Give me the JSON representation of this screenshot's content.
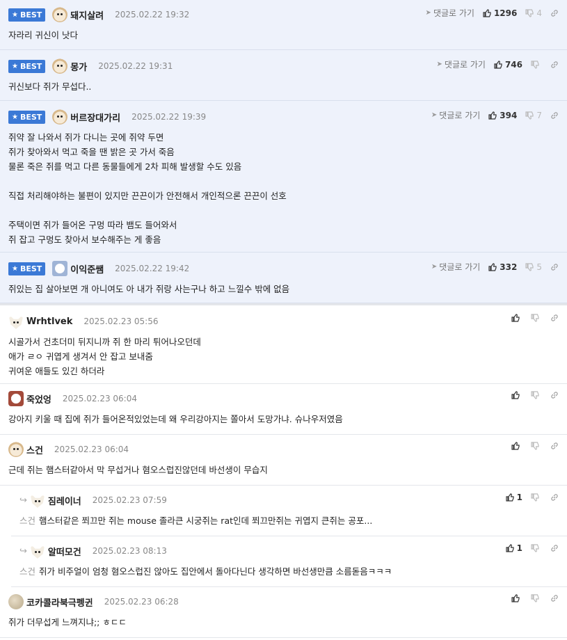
{
  "best_label": "BEST",
  "go_label": "댓글로 가기",
  "comments": [
    {
      "nick": "돼지살려",
      "date": "2025.02.22 19:32",
      "up": "1296",
      "down": "4",
      "text": "자라리 귀신이 낫다"
    },
    {
      "nick": "몽가",
      "date": "2025.02.22 19:31",
      "up": "746",
      "down": "",
      "text": "귀신보다 쥐가 무섭다.."
    },
    {
      "nick": "버르장대가리",
      "date": "2025.02.22 19:39",
      "up": "394",
      "down": "7",
      "text": "쥐약 잘 나와서 쥐가 다니는 곳에 쥐약 두면\n쥐가 찾아와서 먹고 죽을 땐 밝은 곳 가서 죽음\n물론 죽은 쥐를 먹고 다른 동물들에게 2차 피해 발생할 수도 있음\n\n직접 처리해야하는 불편이 있지만 끈끈이가 안전해서 개인적으론 끈끈이 선호\n\n주택이면 쥐가 들어온 구멍 따라 뱀도 들어와서\n쥐 잡고 구멍도 찾아서 보수해주는 게 좋음"
    },
    {
      "nick": "이익준쌤",
      "date": "2025.02.22 19:42",
      "up": "332",
      "down": "5",
      "text": "쥐있는 집 살아보면 개 아니여도 아 내가 쥐랑 사는구나 하고 느낄수 밖에 없음"
    },
    {
      "nick": "Wrhtlvek",
      "date": "2025.02.23 05:56",
      "up": "",
      "down": "",
      "text": "시골가서 건초더미 뒤지니까 쥐 한 마리 튀어나오던데\n애가 ㄹㅇ 귀엽게 생겨서 안 잡고 보내줌\n귀여운 애들도 있긴 하더라"
    },
    {
      "nick": "죽었엉",
      "date": "2025.02.23 06:04",
      "up": "",
      "down": "",
      "text": "강아지 키울 때 집에 쥐가 들어온적있었는데 왜 우리강아지는 쫄아서 도망가냐. 슈나우저였음"
    },
    {
      "nick": "스건",
      "date": "2025.02.23 06:04",
      "up": "",
      "down": "",
      "text": "근데 쥐는 햄스터같아서 막 무섭거나 혐오스럽진않던데 바선생이 무습지"
    },
    {
      "nick": "짐레이너",
      "date": "2025.02.23 07:59",
      "up": "1",
      "down": "",
      "mention": "스건",
      "text": "햄스터같은 쬐끄만 쥐는 mouse 졸라큰 시궁쥐는 rat인데 쬐끄만쥐는 귀엽지 큰쥐는 공포..."
    },
    {
      "nick": "알떠모건",
      "date": "2025.02.23 08:13",
      "up": "1",
      "down": "",
      "mention": "스건",
      "text": "쥐가 비주얼이 엄청 혐오스럽진 않아도 집안에서 돌아다닌다 생각하면 바선생만큼 소름돋음ㅋㅋㅋ"
    },
    {
      "nick": "코카콜라북극펭귄",
      "date": "2025.02.23 06:28",
      "up": "",
      "down": "",
      "text": "쥐가 더무섭게 느껴지냐;; ㅎㄷㄷ"
    }
  ]
}
